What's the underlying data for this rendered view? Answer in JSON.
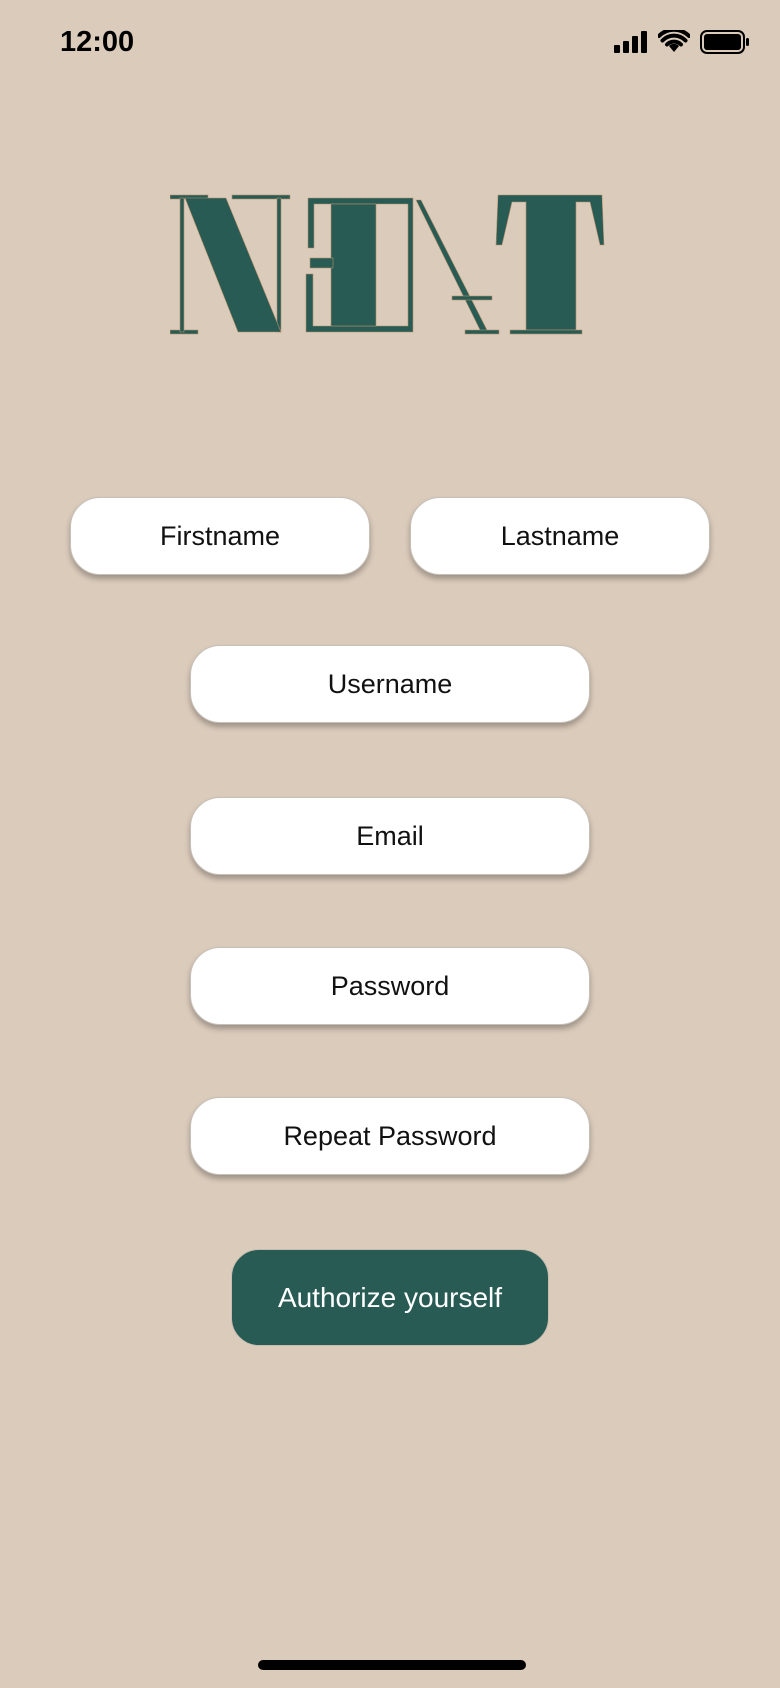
{
  "status_bar": {
    "time": "12:00",
    "icons": [
      "signal-icon",
      "wifi-icon",
      "battery-icon"
    ]
  },
  "logo": {
    "text": "NEAT",
    "color": "#275b54"
  },
  "form": {
    "firstname_placeholder": "Firstname",
    "lastname_placeholder": "Lastname",
    "username_placeholder": "Username",
    "email_placeholder": "Email",
    "password_placeholder": "Password",
    "repeat_password_placeholder": "Repeat Password"
  },
  "submit": {
    "label": "Authorize yourself"
  },
  "colors": {
    "background": "#dbcbbb",
    "accent": "#275b54",
    "field": "#ffffff"
  }
}
